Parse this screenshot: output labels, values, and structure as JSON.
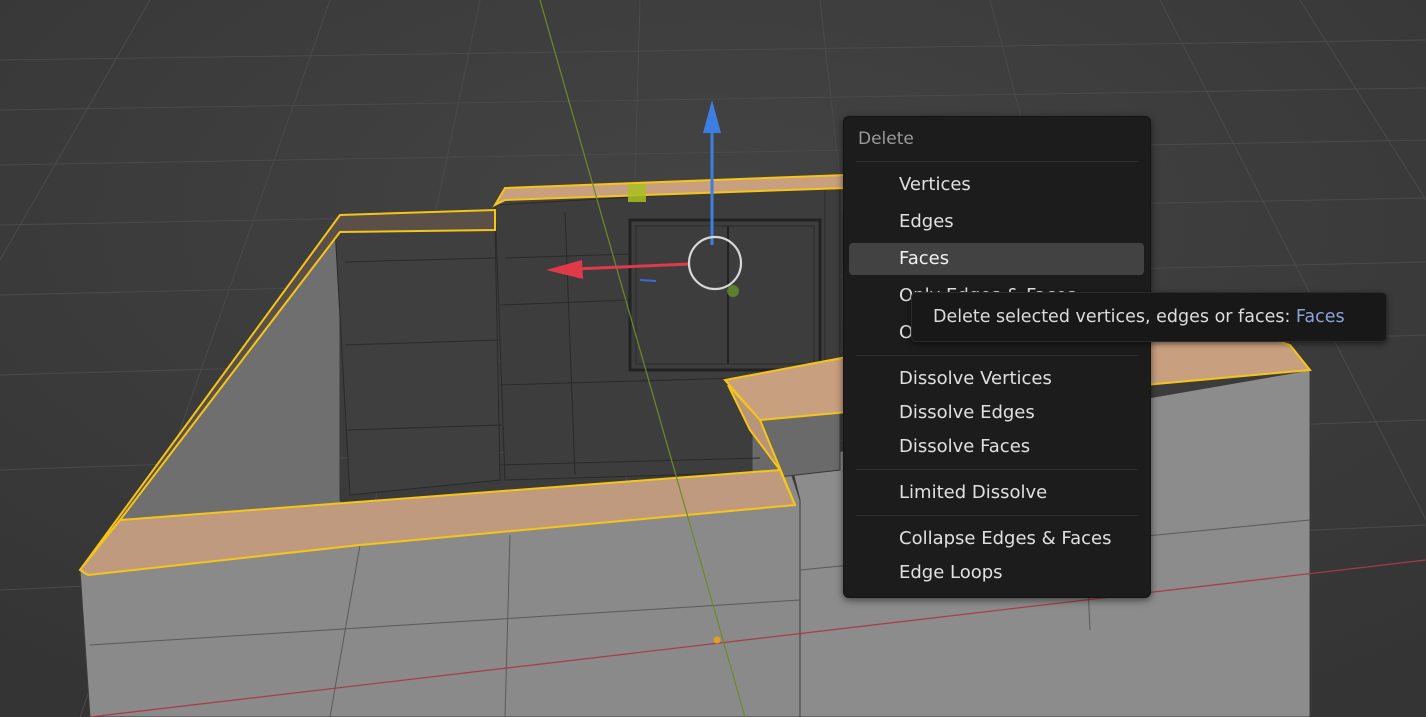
{
  "delete_menu": {
    "title": "Delete",
    "items": [
      {
        "label": "Vertices"
      },
      {
        "label": "Edges"
      },
      {
        "label": "Faces"
      },
      {
        "label": "Only Edges & Faces"
      },
      {
        "label": "Only Faces"
      },
      {
        "label": "Dissolve Vertices"
      },
      {
        "label": "Dissolve Edges"
      },
      {
        "label": "Dissolve Faces"
      },
      {
        "label": "Limited Dissolve"
      },
      {
        "label": "Collapse Edges & Faces"
      },
      {
        "label": "Edge Loops"
      }
    ],
    "active_item": "Faces"
  },
  "tooltip": {
    "text": "Delete selected vertices, edges or faces: ",
    "highlight": "Faces"
  },
  "colors": {
    "selection_outline": "#f5c518",
    "selected_face_fill": "#c8a080",
    "gizmo_z_axis": "#3d7fe0",
    "gizmo_x_axis": "#e03a4a",
    "tooltip_highlight": "#8aa4d8"
  }
}
